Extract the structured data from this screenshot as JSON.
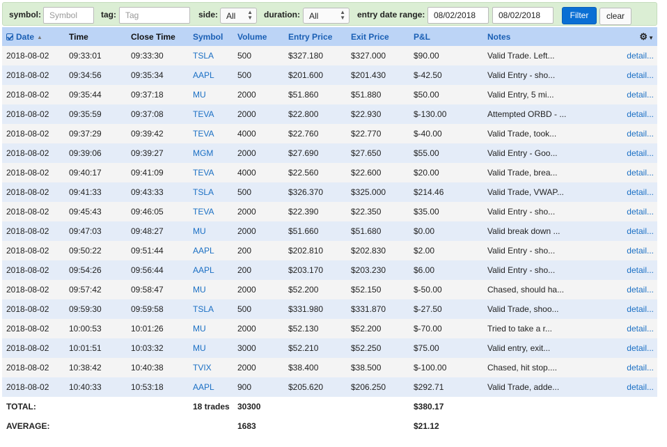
{
  "filters": {
    "symbol_label": "symbol:",
    "symbol_placeholder": "Symbol",
    "tag_label": "tag:",
    "tag_placeholder": "Tag",
    "side_label": "side:",
    "side_value": "All",
    "duration_label": "duration:",
    "duration_value": "All",
    "entry_date_label": "entry date range:",
    "date_from": "08/02/2018",
    "date_to": "08/02/2018",
    "filter_button": "Filter",
    "clear_button": "clear"
  },
  "columns": {
    "date": "Date",
    "time": "Time",
    "close_time": "Close Time",
    "symbol": "Symbol",
    "volume": "Volume",
    "entry_price": "Entry Price",
    "exit_price": "Exit Price",
    "pnl": "P&L",
    "notes": "Notes"
  },
  "rows": [
    [
      "2018-08-02",
      "09:33:01",
      "09:33:30",
      "TSLA",
      "500",
      "$327.180",
      "$327.000",
      "$90.00",
      "Valid Trade. Left...",
      "detail..."
    ],
    [
      "2018-08-02",
      "09:34:56",
      "09:35:34",
      "AAPL",
      "500",
      "$201.600",
      "$201.430",
      "$-42.50",
      "Valid Entry - sho...",
      "detail..."
    ],
    [
      "2018-08-02",
      "09:35:44",
      "09:37:18",
      "MU",
      "2000",
      "$51.860",
      "$51.880",
      "$50.00",
      "Valid Entry, 5 mi...",
      "detail..."
    ],
    [
      "2018-08-02",
      "09:35:59",
      "09:37:08",
      "TEVA",
      "2000",
      "$22.800",
      "$22.930",
      "$-130.00",
      "Attempted ORBD - ...",
      "detail..."
    ],
    [
      "2018-08-02",
      "09:37:29",
      "09:39:42",
      "TEVA",
      "4000",
      "$22.760",
      "$22.770",
      "$-40.00",
      "Valid Trade, took...",
      "detail..."
    ],
    [
      "2018-08-02",
      "09:39:06",
      "09:39:27",
      "MGM",
      "2000",
      "$27.690",
      "$27.650",
      "$55.00",
      "Valid Entry - Goo...",
      "detail..."
    ],
    [
      "2018-08-02",
      "09:40:17",
      "09:41:09",
      "TEVA",
      "4000",
      "$22.560",
      "$22.600",
      "$20.00",
      "Valid Trade, brea...",
      "detail..."
    ],
    [
      "2018-08-02",
      "09:41:33",
      "09:43:33",
      "TSLA",
      "500",
      "$326.370",
      "$325.000",
      "$214.46",
      "Valid Trade, VWAP...",
      "detail..."
    ],
    [
      "2018-08-02",
      "09:45:43",
      "09:46:05",
      "TEVA",
      "2000",
      "$22.390",
      "$22.350",
      "$35.00",
      "Valid Entry - sho...",
      "detail..."
    ],
    [
      "2018-08-02",
      "09:47:03",
      "09:48:27",
      "MU",
      "2000",
      "$51.660",
      "$51.680",
      "$0.00",
      "Valid break down ...",
      "detail..."
    ],
    [
      "2018-08-02",
      "09:50:22",
      "09:51:44",
      "AAPL",
      "200",
      "$202.810",
      "$202.830",
      "$2.00",
      "Valid Entry - sho...",
      "detail..."
    ],
    [
      "2018-08-02",
      "09:54:26",
      "09:56:44",
      "AAPL",
      "200",
      "$203.170",
      "$203.230",
      "$6.00",
      "Valid Entry - sho...",
      "detail..."
    ],
    [
      "2018-08-02",
      "09:57:42",
      "09:58:47",
      "MU",
      "2000",
      "$52.200",
      "$52.150",
      "$-50.00",
      "Chased, should ha...",
      "detail..."
    ],
    [
      "2018-08-02",
      "09:59:30",
      "09:59:58",
      "TSLA",
      "500",
      "$331.980",
      "$331.870",
      "$-27.50",
      "Valid Trade, shoo...",
      "detail..."
    ],
    [
      "2018-08-02",
      "10:00:53",
      "10:01:26",
      "MU",
      "2000",
      "$52.130",
      "$52.200",
      "$-70.00",
      "Tried to take a r...",
      "detail..."
    ],
    [
      "2018-08-02",
      "10:01:51",
      "10:03:32",
      "MU",
      "3000",
      "$52.210",
      "$52.250",
      "$75.00",
      "Valid entry, exit...",
      "detail..."
    ],
    [
      "2018-08-02",
      "10:38:42",
      "10:40:38",
      "TVIX",
      "2000",
      "$38.400",
      "$38.500",
      "$-100.00",
      "Chased, hit stop....",
      "detail..."
    ],
    [
      "2018-08-02",
      "10:40:33",
      "10:53:18",
      "AAPL",
      "900",
      "$205.620",
      "$206.250",
      "$292.71",
      "Valid Trade, adde...",
      "detail..."
    ]
  ],
  "totals": {
    "label": "TOTAL:",
    "trades": "18 trades",
    "volume": "30300",
    "pnl": "$380.17"
  },
  "averages": {
    "label": "AVERAGE:",
    "volume": "1683",
    "pnl": "$21.12"
  }
}
